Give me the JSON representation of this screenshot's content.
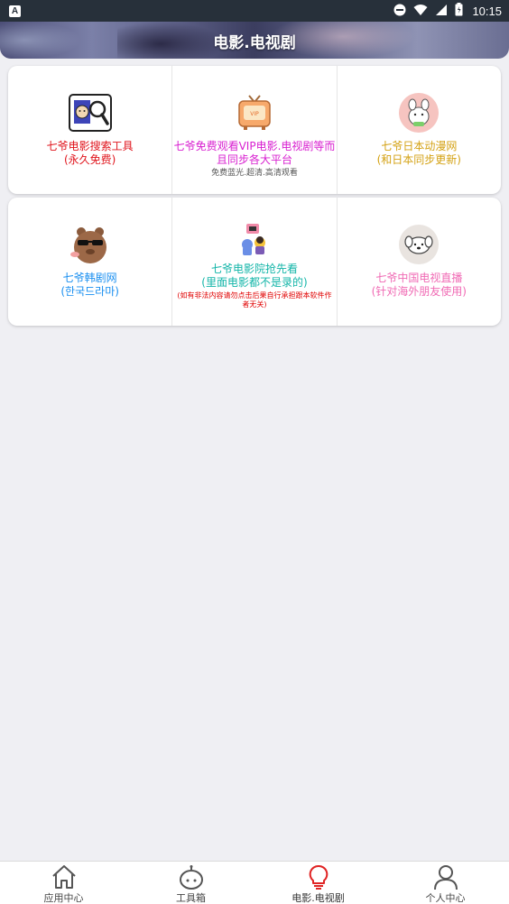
{
  "status_bar": {
    "app_badge": "A",
    "time": "10:15"
  },
  "header": {
    "title": "电影.电视剧"
  },
  "grid_rows": [
    [
      {
        "icon": "movie-search-icon",
        "lines": [
          "七爷电影搜索工具",
          "(永久免费)"
        ],
        "color": "#e0141c"
      },
      {
        "icon": "retro-tv-icon",
        "lines": [
          "七爷免费观看VIP电影.电视剧等而",
          "且同步各大平台"
        ],
        "sub": "免费蓝光.超清.高清观看",
        "color": "#d81fd0"
      },
      {
        "icon": "anime-avatar-icon",
        "lines": [
          "七爷日本动漫网",
          "(和日本同步更新)"
        ],
        "color": "#d4a214"
      }
    ],
    [
      {
        "icon": "cool-bear-icon",
        "lines": [
          "七爷韩剧网",
          "(한국드라마)"
        ],
        "color": "#1a8ff0"
      },
      {
        "icon": "theater-icon",
        "lines": [
          "七爷电影院抢先看",
          "(里面电影都不是录的)"
        ],
        "warn": "(如有非法内容请勿点击后果自行承担跟本软件作者无关)",
        "color": "#12b5a8"
      },
      {
        "icon": "dog-avatar-icon",
        "lines": [
          "七爷中国电视直播",
          "(针对海外朋友使用)"
        ],
        "color": "#f06ab4"
      }
    ]
  ],
  "tabs": [
    {
      "label": "应用中心",
      "icon": "home-icon",
      "active": false
    },
    {
      "label": "工具箱",
      "icon": "robot-icon",
      "active": false
    },
    {
      "label": "电影.电视剧",
      "icon": "lightbulb-icon",
      "active": true
    },
    {
      "label": "个人中心",
      "icon": "person-icon",
      "active": false
    }
  ],
  "colors": {
    "accent": "#e02424",
    "background": "#efeff3",
    "status_bar": "#27303a"
  }
}
